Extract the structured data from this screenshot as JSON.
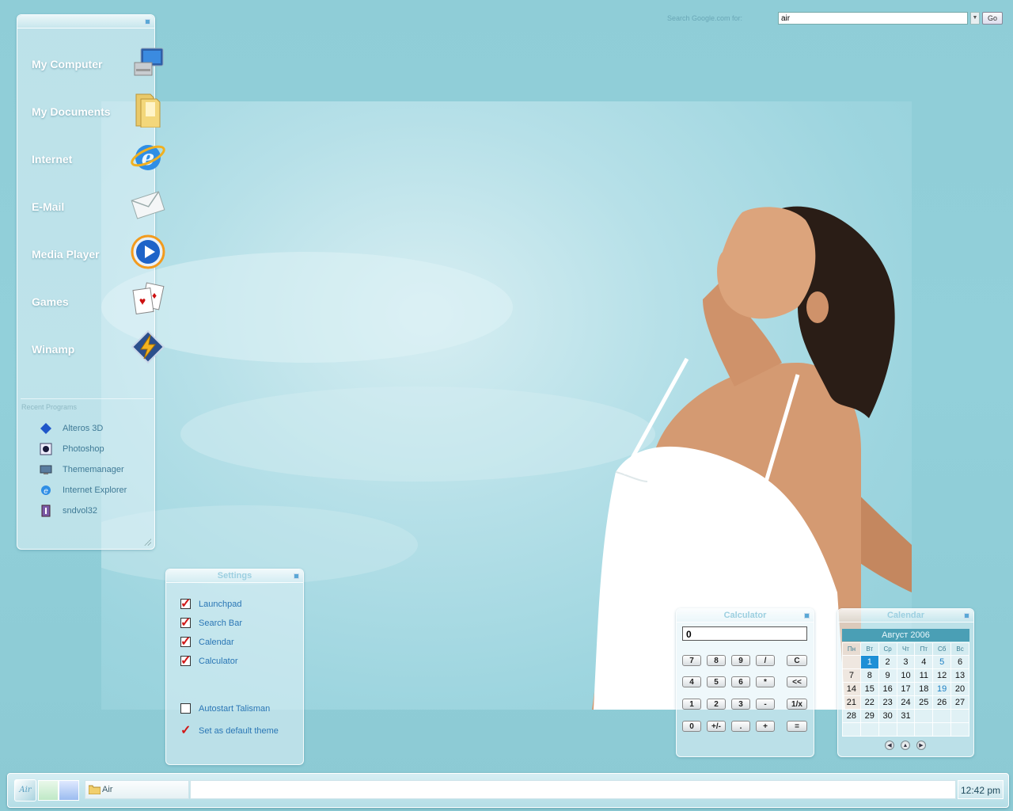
{
  "search": {
    "label": "Search Google.com for:",
    "value": "air",
    "go_label": "Go"
  },
  "launchpad": {
    "items": [
      {
        "label": "My Computer",
        "icon": "computer-icon"
      },
      {
        "label": "My Documents",
        "icon": "folder-icon"
      },
      {
        "label": "Internet",
        "icon": "internet-explorer-icon"
      },
      {
        "label": "E-Mail",
        "icon": "envelope-icon"
      },
      {
        "label": "Media Player",
        "icon": "media-player-icon"
      },
      {
        "label": "Games",
        "icon": "playing-cards-icon"
      },
      {
        "label": "Winamp",
        "icon": "winamp-icon"
      }
    ],
    "recent_title": "Recent Programs",
    "recent": [
      {
        "label": "Alteros 3D",
        "icon": "alteros-icon"
      },
      {
        "label": "Photoshop",
        "icon": "photoshop-icon"
      },
      {
        "label": "Thememanager",
        "icon": "thememanager-icon"
      },
      {
        "label": "Internet Explorer",
        "icon": "internet-explorer-small-icon"
      },
      {
        "label": "sndvol32",
        "icon": "sndvol-icon"
      }
    ]
  },
  "settings": {
    "title": "Settings",
    "options": [
      {
        "label": "Launchpad",
        "checked": true
      },
      {
        "label": "Search Bar",
        "checked": true
      },
      {
        "label": "Calendar",
        "checked": true
      },
      {
        "label": "Calculator",
        "checked": true
      }
    ],
    "autostart_label": "Autostart Talisman",
    "autostart_checked": false,
    "default_theme_label": "Set as default theme"
  },
  "calculator": {
    "title": "Calculator",
    "display": "0",
    "rows": [
      [
        "7",
        "8",
        "9",
        "/",
        "C"
      ],
      [
        "4",
        "5",
        "6",
        "*",
        "<<"
      ],
      [
        "1",
        "2",
        "3",
        "-",
        "1/x"
      ],
      [
        "0",
        "+/-",
        ".",
        "+",
        "="
      ]
    ]
  },
  "calendar": {
    "title": "Calendar",
    "month_label": "Август 2006",
    "weekdays": [
      "Пн",
      "Вт",
      "Ср",
      "Чт",
      "Пт",
      "Сб",
      "Вс"
    ],
    "weeks": [
      [
        "",
        "1",
        "2",
        "3",
        "4",
        "5",
        "6"
      ],
      [
        "7",
        "8",
        "9",
        "10",
        "11",
        "12",
        "13"
      ],
      [
        "14",
        "15",
        "16",
        "17",
        "18",
        "19",
        "20"
      ],
      [
        "21",
        "22",
        "23",
        "24",
        "25",
        "26",
        "27"
      ],
      [
        "28",
        "29",
        "30",
        "31",
        "",
        "",
        ""
      ],
      [
        "",
        "",
        "",
        "",
        "",
        "",
        ""
      ]
    ],
    "today": "1",
    "highlighted": [
      "5",
      "19"
    ]
  },
  "taskbar": {
    "start_label": "Air",
    "task_label": "Air",
    "clock": "12:42 pm"
  },
  "colors": {
    "accent": "#4a9fb5",
    "link": "#2a76b5",
    "check": "#d01818",
    "today": "#1e8fd6"
  }
}
